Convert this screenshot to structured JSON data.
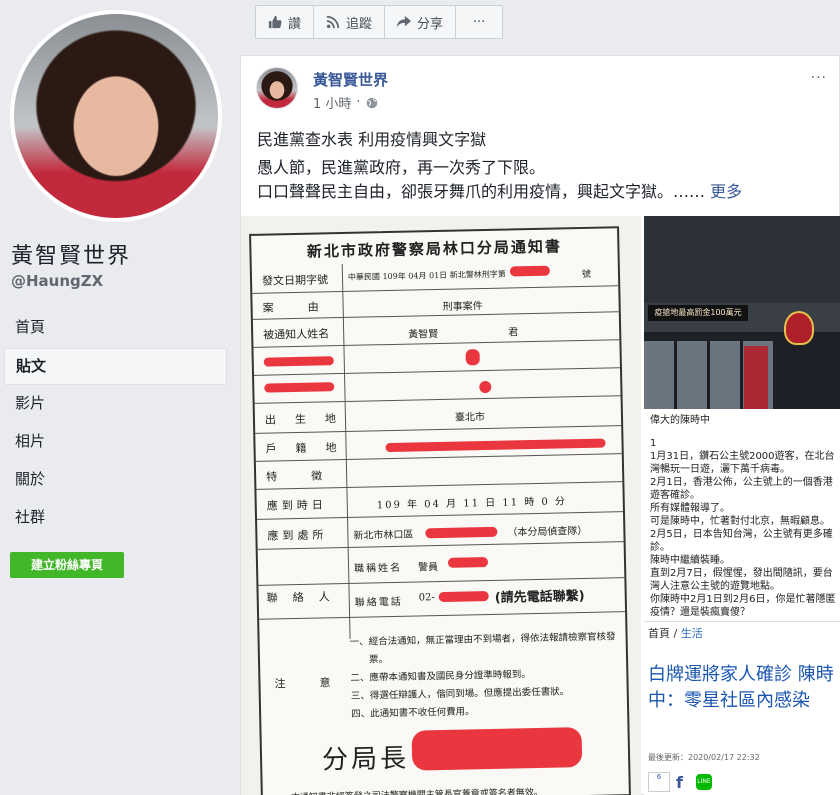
{
  "left": {
    "page_name": "黃智賢世界",
    "handle": "@HaungZX",
    "nav": [
      {
        "label": "首頁",
        "active": false
      },
      {
        "label": "貼文",
        "active": true
      },
      {
        "label": "影片",
        "active": false
      },
      {
        "label": "相片",
        "active": false
      },
      {
        "label": "關於",
        "active": false
      },
      {
        "label": "社群",
        "active": false
      }
    ],
    "create_button": "建立粉絲專頁"
  },
  "actionbar": {
    "like": "讚",
    "follow": "追蹤",
    "share": "分享",
    "more": "···"
  },
  "post": {
    "author": "黃智賢世界",
    "time": "1 小時",
    "more": "···",
    "title": "民進黨查水表 利用疫情興文字獄",
    "line1": "愚人節，民進黨政府，再一次秀了下限。",
    "line2": "口口聲聲民主自由，卻張牙舞爪的利用疫情，興起文字獄。……",
    "see_more": "更多"
  },
  "form": {
    "title": "新北市政府警察局林口分局通知書",
    "issue_label": "發文日期字號",
    "issue_value": "中華民國 109年 04月 01日 新北警林刑字第",
    "issue_suffix": "號",
    "case_label": "案　　由",
    "case_value": "刑事案件",
    "person_label": "被通知人姓名",
    "person_value": "黃智賢",
    "person_suffix": "君",
    "birth_label": "出　生　地",
    "birth_value": "臺北市",
    "domicile_label": "戶　籍　地",
    "feature_label": "特　　徵",
    "time_label": "應到時日",
    "time_value": "109 年 04 月 11 日 11 時 0 分",
    "place_label": "應到處所",
    "place_value": "新北市林口區",
    "place_suffix": "（本分局偵查隊）",
    "contact_label": "聯　絡　人",
    "title_name_label": "職稱姓名",
    "title_name_value": "警員",
    "phone_label": "聯絡電話",
    "phone_value": "02-",
    "phone_note": "(請先電話聯繫)",
    "notes_label": "注　　意",
    "notes": [
      "一、經合法通知，無正當理由不到場者，得依法報請檢察官核發",
      "　　票。",
      "二、應帶本通知書及國民身分證準時報到。",
      "三、得選任辯護人，偕同到場。但應提出委任書狀。",
      "四、此通知書不收任何費用。"
    ],
    "chief": "分局長",
    "footer": "一、本通知書非經簽發之司法警察機關主管長官蓋章或簽名者無效。"
  },
  "side_photo": {
    "sign": "疫搶地最高罰金100萬元"
  },
  "side_text": [
    "偉大的陳時中",
    "",
    "1",
    "1月31日，鑽石公主號2000遊客，在北台灣暢玩一日遊，灑下萬千病毒。",
    "2月1日，香港公佈，公主號上的一個香港遊客確診。",
    "所有媒體報導了。",
    "可是陳時中，忙著對付北京，無暇顧息。",
    "2月5日，日本告知台灣，公主號有更多確診。",
    "陳時中繼續裝睡。",
    "直到2月7日，假惺惺，發出間隨訊，要台灣人注意公主號的遊覽地點。",
    "你陳時中2月1日到2月6日，你是忙著隱匿疫情？還是裝瘋賣傻？"
  ],
  "news": {
    "crumb_home": "首頁",
    "crumb_sep": "/",
    "crumb_section": "生活",
    "headline": "白牌運將家人確診 陳時中：零星社區內感染",
    "updated": "最後更新：2020/02/17 22:32",
    "like_count": "6"
  },
  "colors": {
    "link": "#385898",
    "bg": "#e9ebee",
    "green": "#42b72a",
    "news_blue": "#1a56b0"
  }
}
